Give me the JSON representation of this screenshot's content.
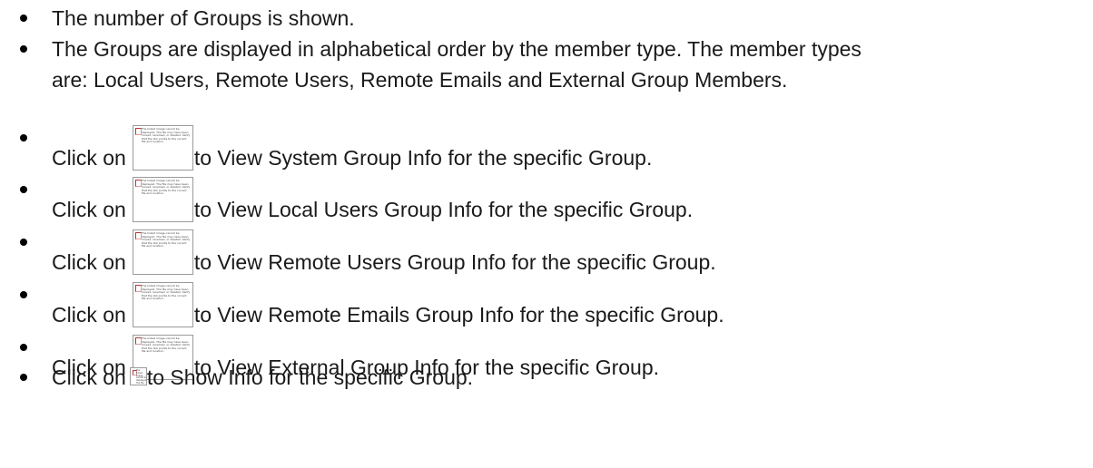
{
  "bullets": [
    {
      "text": "The number of Groups is shown."
    },
    {
      "text": "The Groups are displayed in alphabetical order by the member type. The member types"
    },
    {
      "text": "are: Local Users, Remote Users, Remote Emails and External Group Members."
    },
    {
      "prefix": "Click on",
      "suffix": "to View System Group Info for the specific Group."
    },
    {
      "prefix": "Click on",
      "suffix": "to View Local Users Group Info for the specific Group."
    },
    {
      "prefix": "Click on",
      "suffix": "to View Remote Users Group Info for the specific Group."
    },
    {
      "prefix": "Click on",
      "suffix": "to View Remote Emails Group Info for the specific Group."
    },
    {
      "prefix": "Click on",
      "suffix": "to View External Group Info for the specific Group."
    },
    {
      "prefix": "Click on",
      "suffix": "to Show Info for the specific Group."
    }
  ],
  "broken_image_message": "The linked image cannot be displayed. The file may have been moved, renamed, or deleted. Verify that the link points to the correct file and location.",
  "broken_image_message_short": "The linked image cannot be displayed. The file may have been moved, renamed, o..."
}
